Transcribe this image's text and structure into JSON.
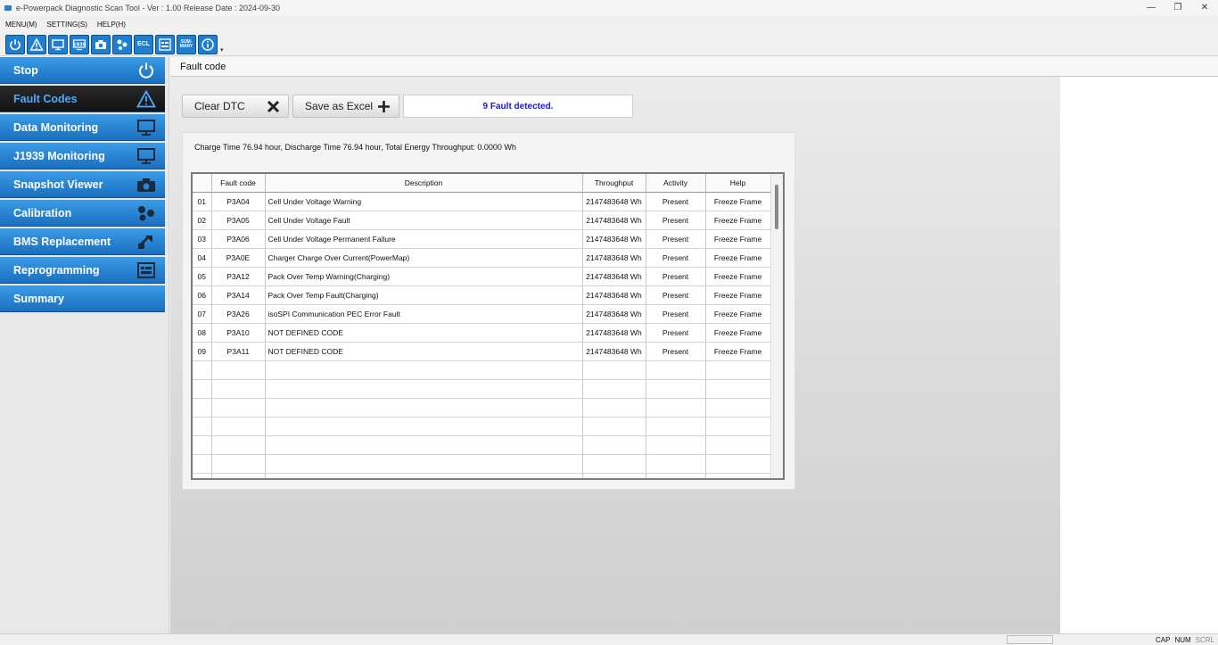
{
  "window": {
    "title": "e-Powerpack Diagnostic Scan Tool - Ver : 1.00 Release Date : 2024-09-30",
    "controls": [
      "—",
      "❐",
      "✕"
    ]
  },
  "menu": [
    "MENU(M)",
    "SETTING(S)",
    "HELP(H)"
  ],
  "toolbar": {
    "buttons": [
      {
        "name": "power-icon"
      },
      {
        "name": "warning-icon"
      },
      {
        "name": "monitor-icon"
      },
      {
        "name": "monitor-1939-icon",
        "label": "1939"
      },
      {
        "name": "camera-icon"
      },
      {
        "name": "calibration-icon"
      },
      {
        "name": "ecl-icon",
        "label": "ECL"
      },
      {
        "name": "reprogram-icon"
      },
      {
        "name": "summary-icon",
        "label": "SUM-MARY"
      },
      {
        "name": "info-icon"
      }
    ]
  },
  "sidebar": {
    "items": [
      {
        "label": "Stop",
        "icon": "power-icon"
      },
      {
        "label": "Fault Codes",
        "icon": "warning-icon",
        "active": true
      },
      {
        "label": "Data Monitoring",
        "icon": "monitor-icon"
      },
      {
        "label": "J1939 Monitoring",
        "icon": "monitor-icon"
      },
      {
        "label": "Snapshot Viewer",
        "icon": "camera-icon"
      },
      {
        "label": "Calibration",
        "icon": "calibration-icon"
      },
      {
        "label": "BMS Replacement",
        "icon": "swap-icon"
      },
      {
        "label": "Reprogramming",
        "icon": "reprogram-icon"
      },
      {
        "label": "Summary",
        "icon": ""
      }
    ]
  },
  "main": {
    "section_title": "Fault code",
    "clear_label": "Clear DTC",
    "excel_label": "Save as Excel",
    "status": "9 Fault detected.",
    "summary": "Charge Time 76.94 hour, Discharge Time 76.94 hour, Total Energy Throughput: 0.0000 Wh"
  },
  "table": {
    "headers": [
      "",
      "Fault code",
      "Description",
      "Throughput",
      "Activity",
      "Help"
    ],
    "rows": [
      [
        "01",
        "P3A04",
        "Cell Under Voltage Warning",
        "2147483648 Wh",
        "Present",
        "Freeze Frame"
      ],
      [
        "02",
        "P3A05",
        "Cell Under Voltage Fault",
        "2147483648 Wh",
        "Present",
        "Freeze Frame"
      ],
      [
        "03",
        "P3A06",
        "Cell Under Voltage Permanent Failure",
        "2147483648 Wh",
        "Present",
        "Freeze Frame"
      ],
      [
        "04",
        "P3A0E",
        "Charger Charge Over Current(PowerMap)",
        "2147483648 Wh",
        "Present",
        "Freeze Frame"
      ],
      [
        "05",
        "P3A12",
        "Pack Over Temp Warning(Charging)",
        "2147483648 Wh",
        "Present",
        "Freeze Frame"
      ],
      [
        "06",
        "P3A14",
        "Pack Over Temp Fault(Charging)",
        "2147483648 Wh",
        "Present",
        "Freeze Frame"
      ],
      [
        "07",
        "P3A26",
        "isoSPI Communication PEC Error Fault",
        "2147483648 Wh",
        "Present",
        "Freeze Frame"
      ],
      [
        "08",
        "P3A10",
        "NOT DEFINED CODE",
        "2147483648 Wh",
        "Present",
        "Freeze Frame"
      ],
      [
        "09",
        "P3A11",
        "NOT DEFINED CODE",
        "2147483648 Wh",
        "Present",
        "Freeze Frame"
      ]
    ],
    "empty_rows": 7
  },
  "statusbar": {
    "indicators": [
      "CAP",
      "NUM",
      "SCRL"
    ]
  },
  "colors": {
    "nav_blue": "#1a6fbf",
    "nav_active": "#111111",
    "status_text": "#1a1ac8"
  }
}
